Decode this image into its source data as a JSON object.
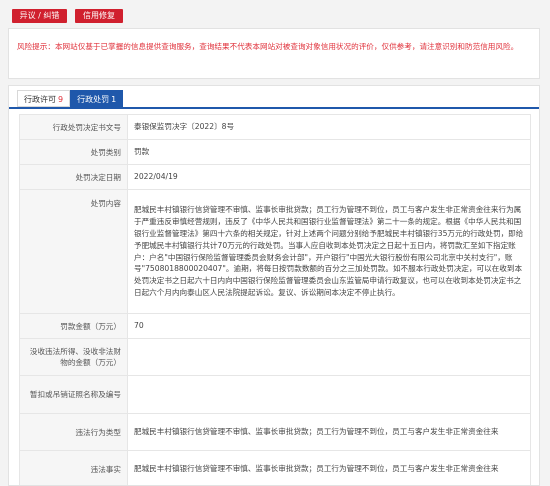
{
  "buttons": {
    "objection": "异议 / 纠错",
    "credit_repair": "信用修复"
  },
  "notice": "风险提示：本网站仅基于已掌握的信息提供查询服务，查询结果不代表本网站对被查询对象信用状况的评价，仅供参考，请注意识别和防范信用风险。",
  "tabs": [
    {
      "label": "行政许可",
      "count": "9"
    },
    {
      "label": "行政处罚",
      "count": "1"
    }
  ],
  "rows": [
    {
      "key": "行政处罚决定书文号",
      "value": "泰银保监罚决字〔2022〕8号"
    },
    {
      "key": "处罚类别",
      "value": "罚款"
    },
    {
      "key": "处罚决定日期",
      "value": "2022/04/19"
    },
    {
      "key": "处罚内容",
      "value": "肥城民丰村镇银行信贷管理不审慎、监事长审批贷款；员工行为管理不到位，员工与客户发生非正常资金往来行为属于严重违反审慎经营规则，违反了《中华人民共和国银行业监督管理法》第二十一条的规定。根据《中华人民共和国银行业监督管理法》第四十六条的相关规定，针对上述两个问题分别给予肥城民丰村镇银行35万元的行政处罚，即给予肥城民丰村镇银行共计70万元的行政处罚。当事人应自收到本处罚决定之日起十五日内，将罚款汇至如下指定账户：户名\"中国银行保险监督管理委员会财务会计部\"，开户银行\"中国光大银行股份有限公司北京中关村支行\"，账号\"7508018800020407\"。逾期，将每日按罚款数额的百分之三加处罚款。如不服本行政处罚决定，可以在收到本处罚决定书之日起六十日内向中国银行保险监督管理委员会山东监管局申请行政复议，也可以在收到本处罚决定书之日起六个月内向泰山区人民法院提起诉讼。复议、诉讼期间本决定不停止执行。"
    },
    {
      "key": "罚款金额（万元）",
      "value": "70"
    },
    {
      "key": "没收违法所得、没收非法财物的金额（万元）",
      "value": ""
    },
    {
      "key": "暂扣或吊销证照名称及编号",
      "value": ""
    },
    {
      "key": "违法行为类型",
      "value": "肥城民丰村镇银行信贷管理不审慎、监事长审批贷款；员工行为管理不到位，员工与客户发生非正常资金往来"
    },
    {
      "key": "违法事实",
      "value": "肥城民丰村镇银行信贷管理不审慎、监事长审批贷款；员工行为管理不到位，员工与客户发生非正常资金往来"
    }
  ]
}
